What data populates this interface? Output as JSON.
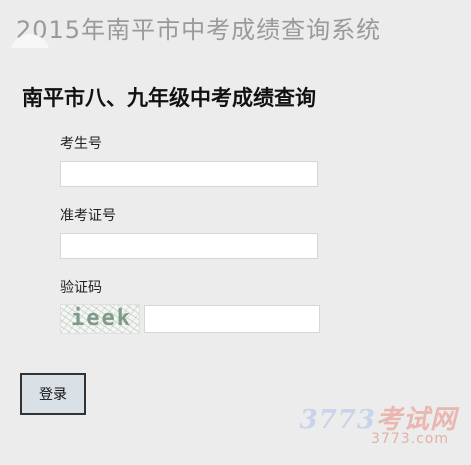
{
  "header": {
    "title": "2015年南平市中考成绩查询系统"
  },
  "form": {
    "heading": "南平市八、九年级中考成绩查询",
    "exam_number": {
      "label": "考生号",
      "value": ""
    },
    "exam_id": {
      "label": "准考证号",
      "value": ""
    },
    "captcha": {
      "label": "验证码",
      "image_text": "ieek",
      "value": ""
    },
    "login_label": "登录"
  },
  "watermark": {
    "brand": "3773考试网",
    "brand_number": "3773",
    "brand_suffix": "考试网",
    "url": "3773.com"
  }
}
